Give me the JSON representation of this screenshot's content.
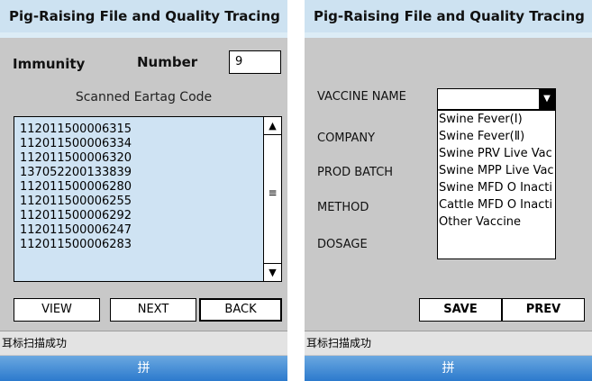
{
  "colors": {
    "title_bar": "#cde2f1",
    "screen_bg": "#c8c8c8",
    "list_bg": "#cfe3f3",
    "ime_bar": "#2c7acd"
  },
  "left": {
    "title": "Pig-Raising File and Quality Tracing",
    "immunity_label": "Immunity",
    "number_label": "Number",
    "number_value": "9",
    "scan_title": "Scanned Eartag Code",
    "eartags": [
      "112011500006315",
      "112011500006334",
      "112011500006320",
      "137052200133839",
      "112011500006280",
      "112011500006255",
      "112011500006292",
      "112011500006247",
      "112011500006283"
    ],
    "buttons": {
      "view": "VIEW",
      "next": "NEXT",
      "back": "BACK"
    },
    "status": "耳标扫描成功",
    "ime": "拼"
  },
  "right": {
    "title": "Pig-Raising File and Quality Tracing",
    "labels": {
      "vaccine": "VACCINE NAME",
      "company": "COMPANY",
      "batch": "PROD BATCH",
      "method": "METHOD",
      "dosage": "DOSAGE"
    },
    "vaccine_selected": "",
    "vaccine_options": [
      "Swine Fever(Ⅰ)",
      "Swine Fever(Ⅱ)",
      "Swine PRV Live Vac",
      "Swine MPP Live Vac",
      "Swine MFD O Inacti",
      "Cattle MFD O Inacti",
      "Other Vaccine"
    ],
    "buttons": {
      "save": "SAVE",
      "prev": "PREV"
    },
    "status": "耳标扫描成功",
    "ime": "拼"
  }
}
